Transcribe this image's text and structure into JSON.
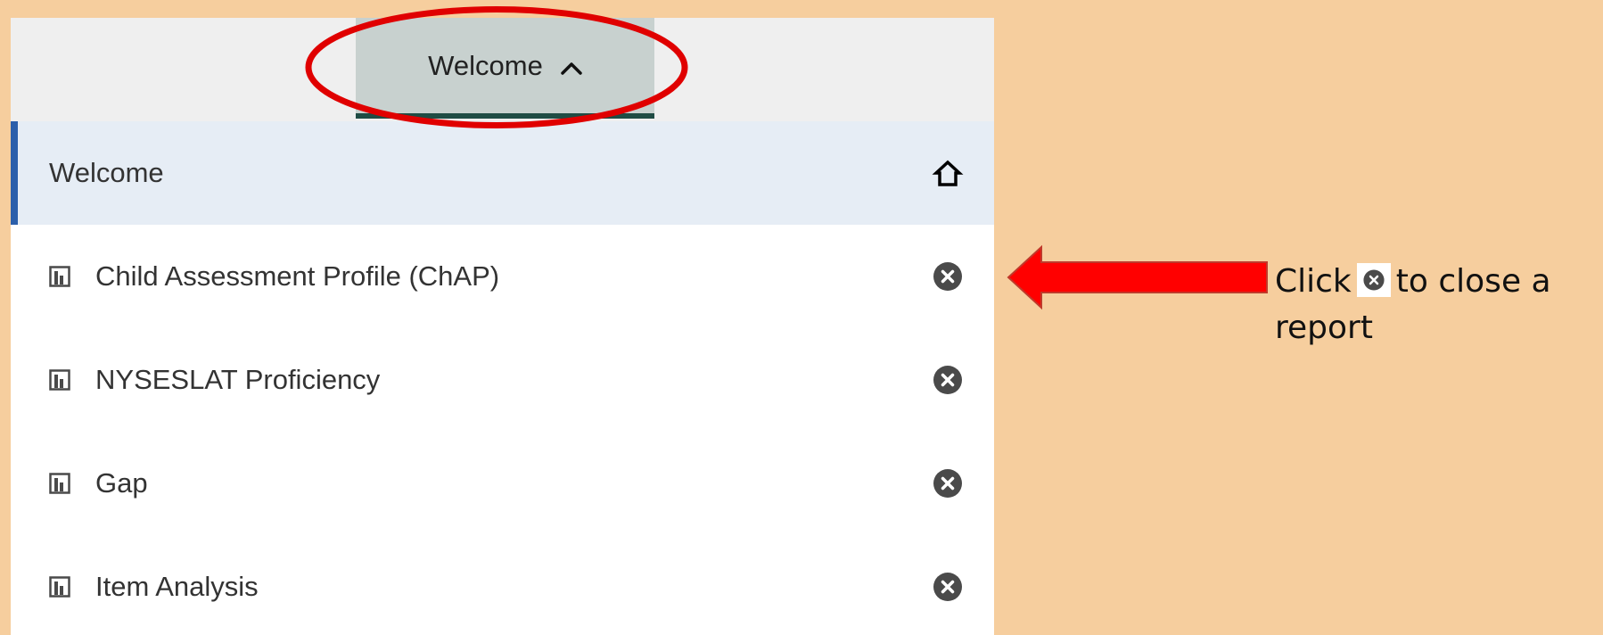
{
  "header": {
    "tab_label": "Welcome"
  },
  "home_row": {
    "label": "Welcome",
    "icon": "home-icon"
  },
  "reports": [
    {
      "label": "Child Assessment Profile (ChAP)",
      "icon": "report-icon",
      "action_icon": "close-icon"
    },
    {
      "label": "NYSESLAT Proficiency",
      "icon": "report-icon",
      "action_icon": "close-icon"
    },
    {
      "label": "Gap",
      "icon": "report-icon",
      "action_icon": "close-icon"
    },
    {
      "label": "Item Analysis",
      "icon": "report-icon",
      "action_icon": "close-icon"
    }
  ],
  "annotation": {
    "text_before": "Click",
    "text_after": "to close a report",
    "arrow_color": "#FF0000",
    "highlight_color": "#E00000"
  },
  "colors": {
    "background": "#F6CE9E",
    "tab_active": "#C8D1CF",
    "tab_underline": "#1F4C44",
    "home_row_bg": "#E6EDF5",
    "home_row_accent": "#2C5FAA"
  }
}
